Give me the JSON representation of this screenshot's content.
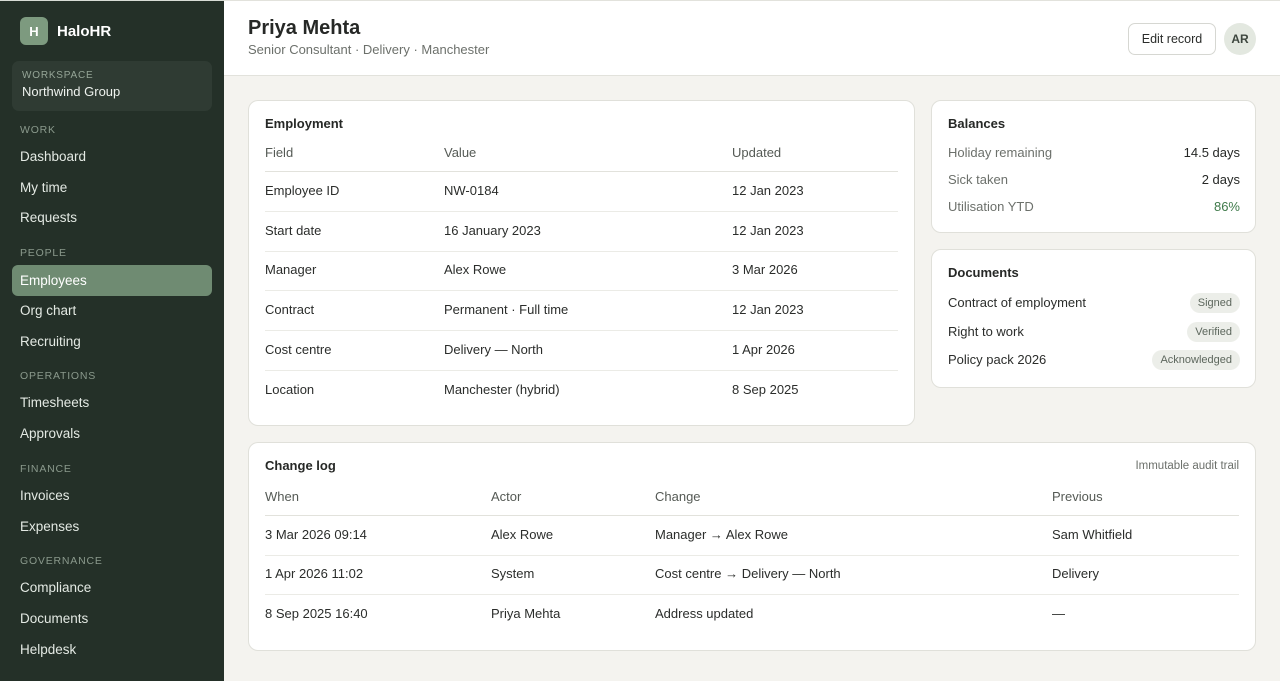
{
  "app": {
    "logo_letter": "H",
    "name": "HaloHR"
  },
  "workspace": {
    "label": "Workspace",
    "name": "Northwind Group"
  },
  "sidebar": {
    "sections": [
      {
        "label": "Work",
        "items": [
          "Dashboard",
          "My time",
          "Requests"
        ]
      },
      {
        "label": "People",
        "items": [
          "Employees",
          "Org chart",
          "Recruiting"
        ]
      },
      {
        "label": "Operations",
        "items": [
          "Timesheets",
          "Approvals"
        ]
      },
      {
        "label": "Finance",
        "items": [
          "Invoices",
          "Expenses"
        ]
      },
      {
        "label": "Governance",
        "items": [
          "Compliance",
          "Documents",
          "Helpdesk"
        ]
      }
    ],
    "active_item": "Employees"
  },
  "header": {
    "name": "Priya Mehta",
    "subtitle": "Senior Consultant · Delivery · Manchester",
    "edit_label": "Edit record",
    "avatar_initials": "AR"
  },
  "employment": {
    "title": "Employment",
    "columns": [
      "Field",
      "Value",
      "Updated"
    ],
    "rows": [
      [
        "Employee ID",
        "NW-0184",
        "12 Jan 2023"
      ],
      [
        "Start date",
        "16 January 2023",
        "12 Jan 2023"
      ],
      [
        "Manager",
        "Alex Rowe",
        "3 Mar 2026"
      ],
      [
        "Contract",
        "Permanent · Full time",
        "12 Jan 2023"
      ],
      [
        "Cost centre",
        "Delivery — North",
        "1 Apr 2026"
      ],
      [
        "Location",
        "Manchester (hybrid)",
        "8 Sep 2025"
      ]
    ]
  },
  "balances": {
    "title": "Balances",
    "rows": [
      {
        "label": "Holiday remaining",
        "value": "14.5 days"
      },
      {
        "label": "Sick taken",
        "value": "2 days"
      },
      {
        "label": "Utilisation YTD",
        "value": "86%"
      }
    ],
    "highlight_color": "#3f7a4a"
  },
  "documents": {
    "title": "Documents",
    "rows": [
      {
        "label": "Contract of employment",
        "status": "Signed"
      },
      {
        "label": "Right to work",
        "status": "Verified"
      },
      {
        "label": "Policy pack 2026",
        "status": "Acknowledged"
      }
    ]
  },
  "changelog": {
    "title": "Change log",
    "note": "Immutable audit trail",
    "columns": [
      "When",
      "Actor",
      "Change",
      "Previous"
    ],
    "rows": [
      [
        "3 Mar 2026 09:14",
        "Alex Rowe",
        "Manager → Alex Rowe",
        "Sam Whitfield"
      ],
      [
        "1 Apr 2026 11:02",
        "System",
        "Cost centre → Delivery — North",
        "Delivery"
      ],
      [
        "8 Sep 2025 16:40",
        "Priya Mehta",
        "Address updated",
        "—"
      ]
    ]
  }
}
